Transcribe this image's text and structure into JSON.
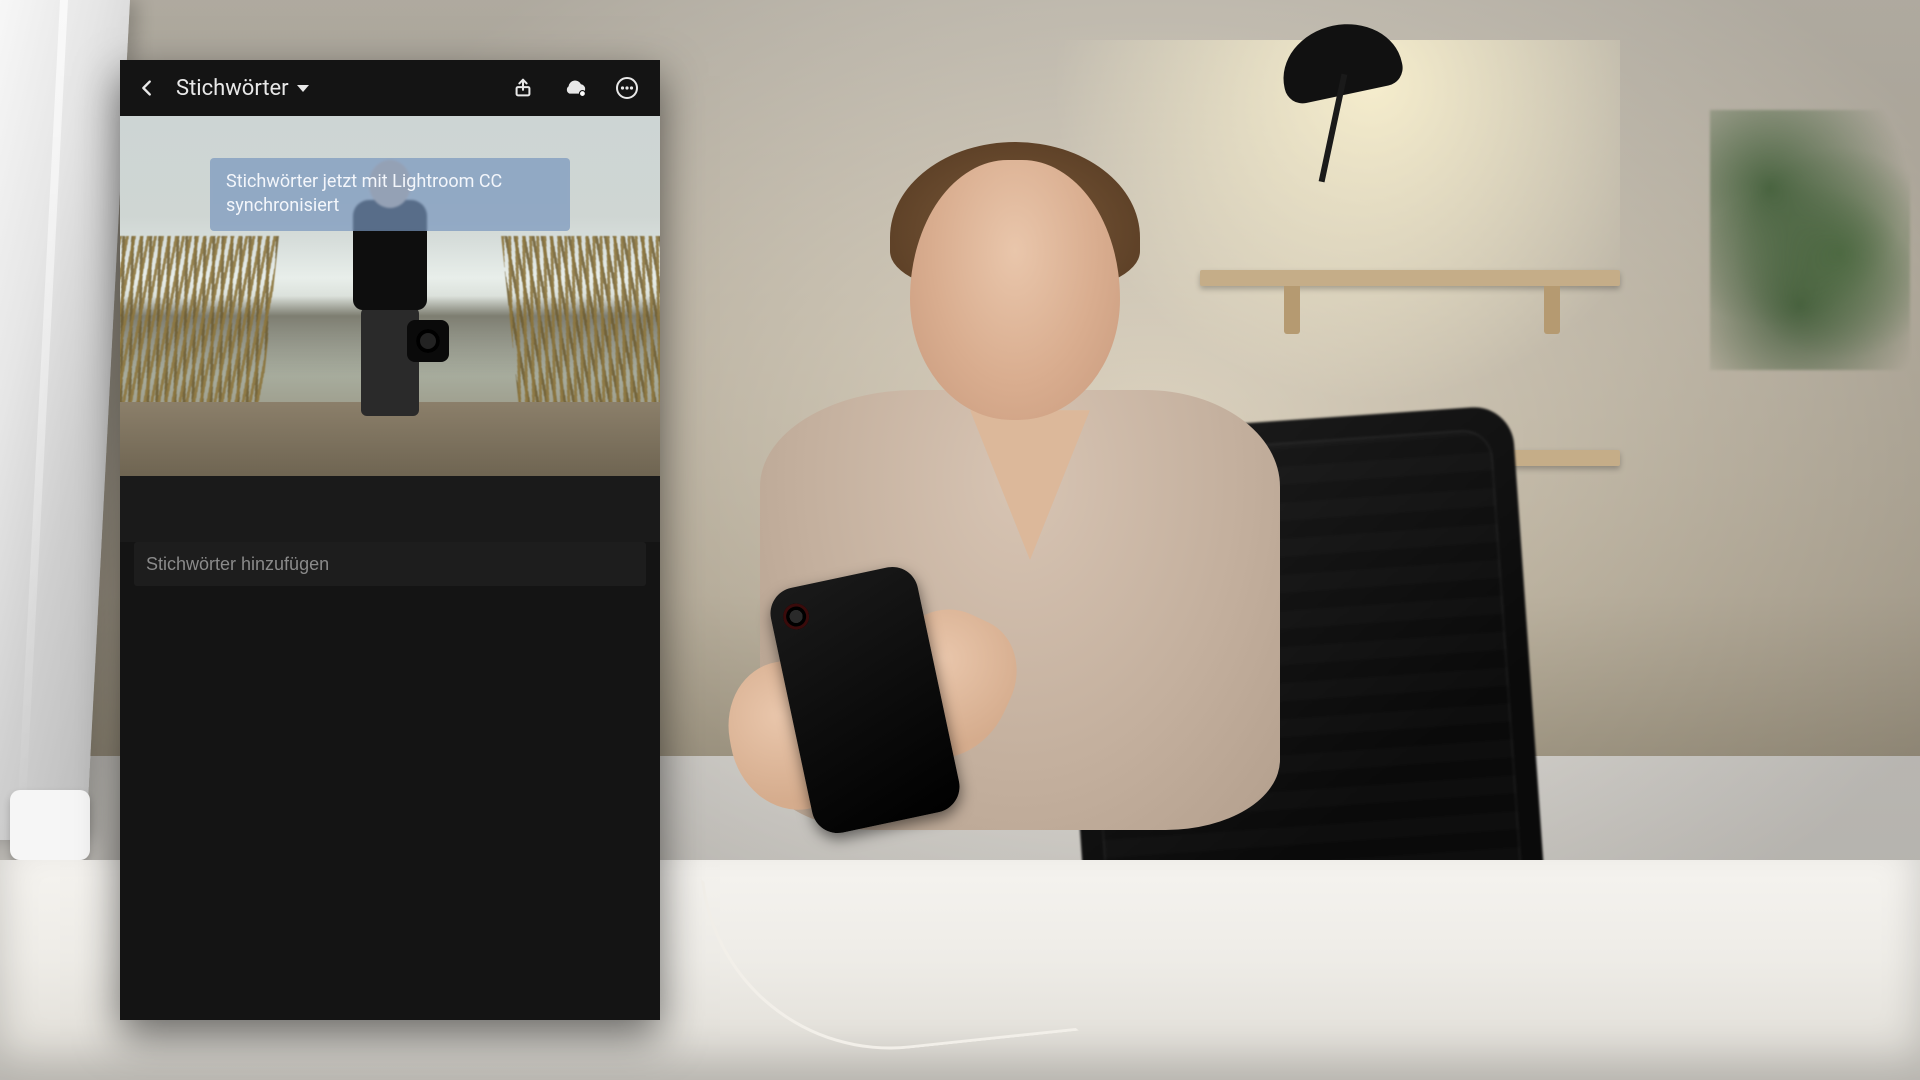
{
  "header": {
    "title": "Stichwörter"
  },
  "toast": {
    "line1": "Stichwörter jetzt mit Lightroom CC",
    "line2": "synchronisiert"
  },
  "keywords": {
    "input_placeholder": "Stichwörter hinzufügen"
  }
}
